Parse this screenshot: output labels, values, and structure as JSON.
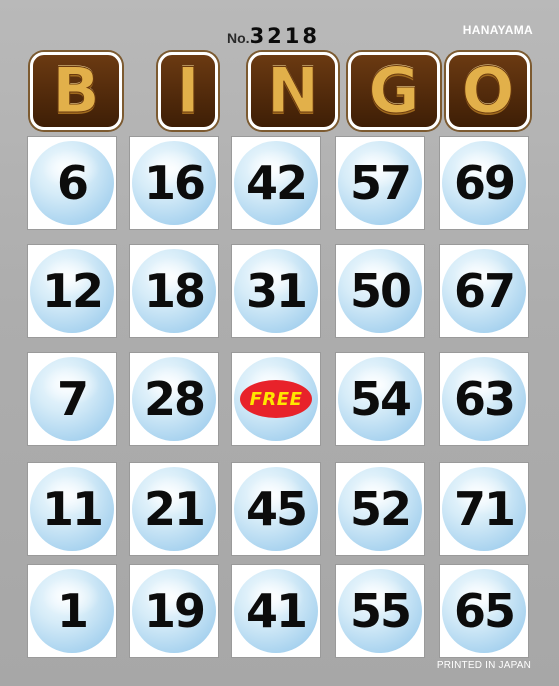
{
  "brand": "HANAYAMA",
  "serial": {
    "prefix": "No.",
    "number": "3218"
  },
  "title_letters": [
    "B",
    "I",
    "N",
    "G",
    "O"
  ],
  "grid": [
    [
      "6",
      "16",
      "42",
      "57",
      "69"
    ],
    [
      "12",
      "18",
      "31",
      "50",
      "67"
    ],
    [
      "7",
      "28",
      "FREE",
      "54",
      "63"
    ],
    [
      "11",
      "21",
      "45",
      "52",
      "71"
    ],
    [
      "1",
      "19",
      "41",
      "55",
      "65"
    ]
  ],
  "free_label": "FREE",
  "footer": "PRINTED IN JAPAN",
  "colors": {
    "card_background": "#adadad",
    "ball": "#a9d3ef",
    "free_badge": "#e8222a",
    "free_text": "#ffe600",
    "title_tile": "#4e2a0b",
    "title_gold": "#e2b04a"
  }
}
